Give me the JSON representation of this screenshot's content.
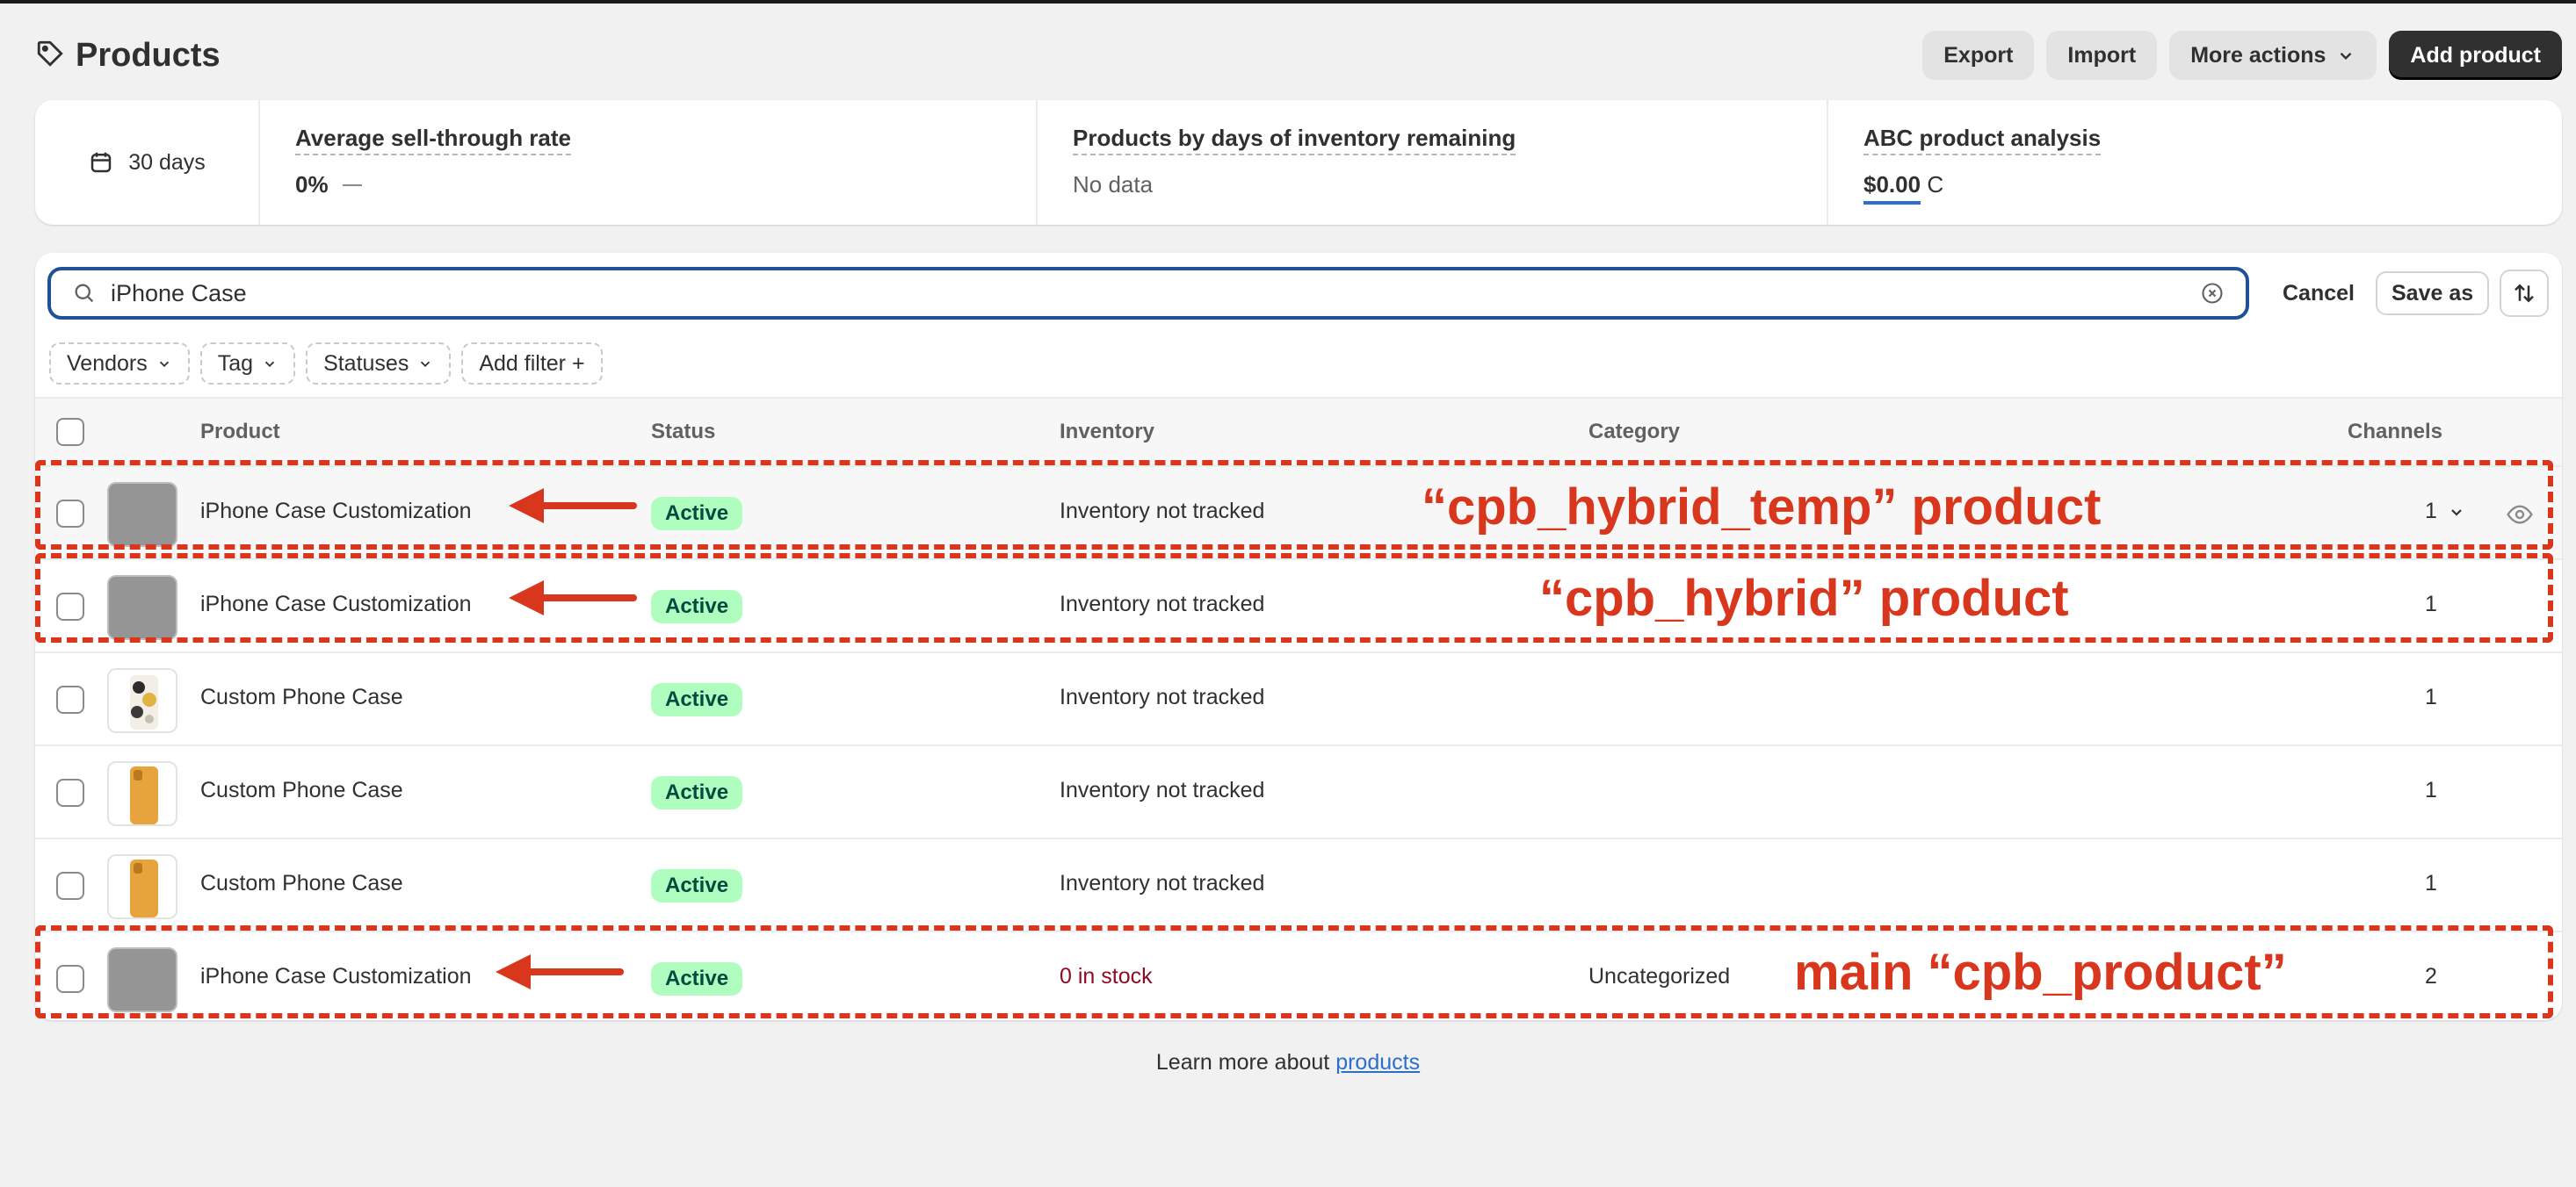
{
  "header": {
    "title": "Products",
    "actions": {
      "export": "Export",
      "import": "Import",
      "more": "More actions",
      "add": "Add product"
    }
  },
  "metrics": {
    "date_range": "30 days",
    "sell_through": {
      "label": "Average sell-through rate",
      "value": "0%"
    },
    "days_inventory": {
      "label": "Products by days of inventory remaining",
      "value": "No data"
    },
    "abc": {
      "label": "ABC product analysis",
      "value": "$0.00",
      "suffix": "C"
    }
  },
  "search": {
    "value": "iPhone Case",
    "cancel": "Cancel",
    "save_as": "Save as"
  },
  "filters": [
    "Vendors",
    "Tag",
    "Statuses",
    "Add filter +"
  ],
  "columns": {
    "product": "Product",
    "status": "Status",
    "inventory": "Inventory",
    "category": "Category",
    "channels": "Channels"
  },
  "rows": [
    {
      "name": "iPhone Case Customization",
      "status": "Active",
      "inventory": "Inventory not tracked",
      "category": "",
      "channels": "1",
      "thumb": "grey"
    },
    {
      "name": "iPhone Case Customization",
      "status": "Active",
      "inventory": "Inventory not tracked",
      "category": "",
      "channels": "1",
      "thumb": "grey"
    },
    {
      "name": "Custom Phone Case",
      "status": "Active",
      "inventory": "Inventory not tracked",
      "category": "",
      "channels": "1",
      "thumb": "floral"
    },
    {
      "name": "Custom Phone Case",
      "status": "Active",
      "inventory": "Inventory not tracked",
      "category": "",
      "channels": "1",
      "thumb": "orange"
    },
    {
      "name": "Custom Phone Case",
      "status": "Active",
      "inventory": "Inventory not tracked",
      "category": "",
      "channels": "1",
      "thumb": "orange"
    },
    {
      "name": "iPhone Case Customization",
      "status": "Active",
      "inventory": "0 in stock",
      "category": "Uncategorized",
      "channels": "2",
      "thumb": "grey"
    }
  ],
  "footer": {
    "text": "Learn more about",
    "link": "products"
  },
  "annotations": {
    "row1": "“cpb_hybrid_temp” product",
    "row2": "“cpb_hybrid” product",
    "row6": "main “cpb_product”"
  },
  "colors": {
    "accent_red": "#d9371d",
    "badge_green": "#affebf",
    "focus_blue": "#1f5199",
    "link_blue": "#2c6ecb"
  }
}
